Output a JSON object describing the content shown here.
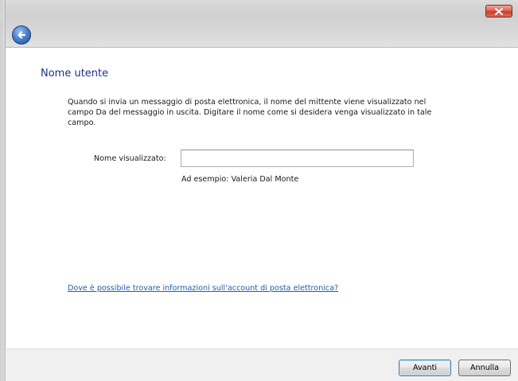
{
  "window": {
    "close_label": "Close"
  },
  "page": {
    "title": "Nome utente",
    "description": "Quando si invia un messaggio di posta elettronica, il nome del mittente viene visualizzato nel campo Da del messaggio in uscita. Digitare il nome come si desidera venga visualizzato in tale campo."
  },
  "form": {
    "display_name_label": "Nome visualizzato:",
    "display_name_value": "",
    "example_text": "Ad esempio: Valeria Dal Monte"
  },
  "help": {
    "link_text": "Dove è possibile trovare informazioni sull'account di posta elettronica?"
  },
  "buttons": {
    "next_label": "Avanti",
    "cancel_label": "Annulla"
  },
  "colors": {
    "title_blue": "#1e3287",
    "link_blue": "#1f5dad",
    "close_red": "#c43f2a"
  }
}
